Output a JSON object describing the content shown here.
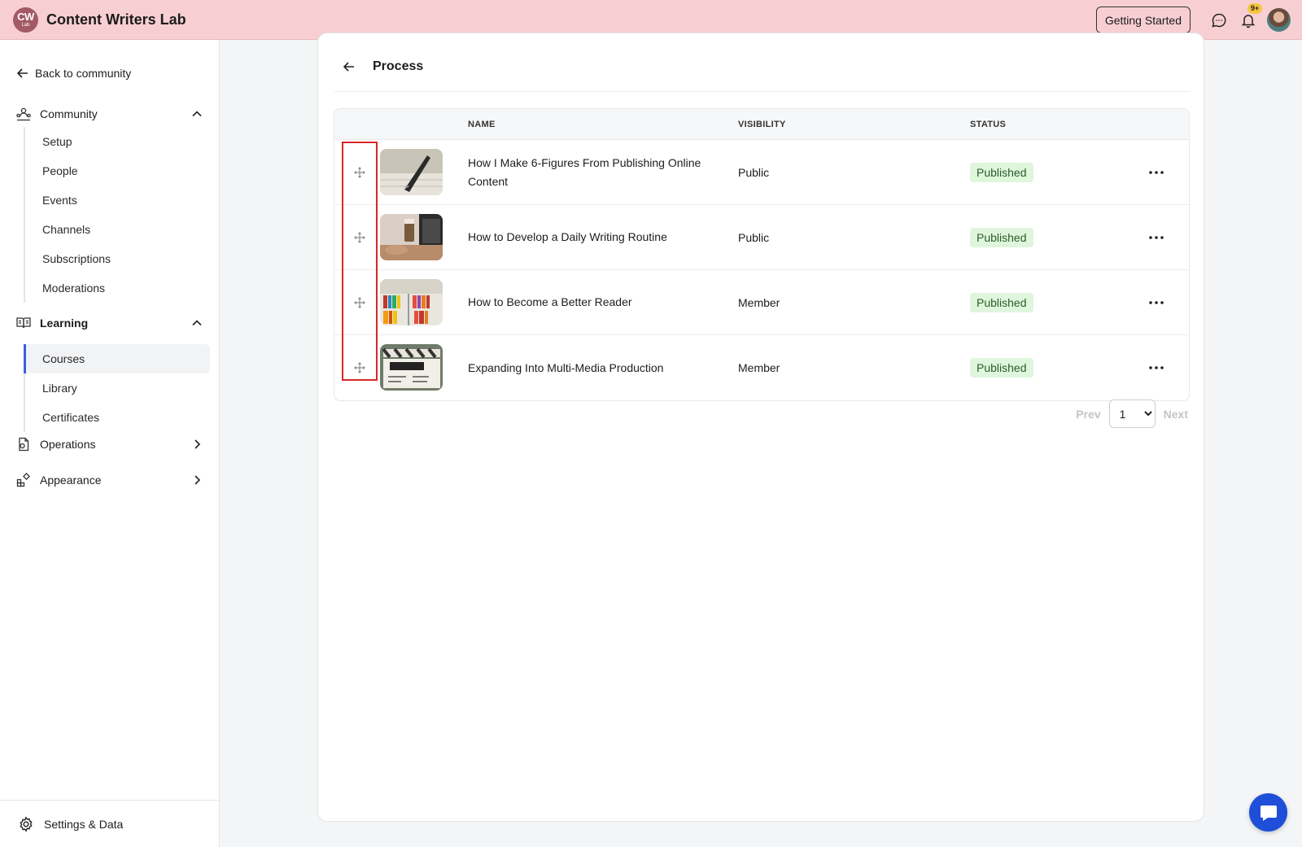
{
  "app": {
    "logo_text": "CW",
    "logo_subtext": "Lab",
    "title": "Content Writers Lab"
  },
  "header": {
    "getting_started_label": "Getting Started",
    "notifications_badge": "9+"
  },
  "sidebar": {
    "back_label": "Back to community",
    "sections": [
      {
        "label": "Community",
        "icon": "community-icon",
        "expanded": true,
        "items": [
          "Setup",
          "People",
          "Events",
          "Channels",
          "Subscriptions",
          "Moderations"
        ]
      },
      {
        "label": "Learning",
        "icon": "book-icon",
        "expanded": true,
        "items": [
          "Courses",
          "Library",
          "Certificates"
        ],
        "active_item": "Courses"
      },
      {
        "label": "Operations",
        "icon": "operations-icon",
        "expanded": false
      },
      {
        "label": "Appearance",
        "icon": "appearance-icon",
        "expanded": false
      }
    ],
    "footer_label": "Settings & Data"
  },
  "panel": {
    "title": "Process",
    "columns": {
      "name": "NAME",
      "visibility": "VISIBILITY",
      "status": "STATUS"
    },
    "rows": [
      {
        "name": "How I Make 6-Figures From Publishing Online Content",
        "visibility": "Public",
        "status": "Published"
      },
      {
        "name": "How to Develop a Daily Writing Routine",
        "visibility": "Public",
        "status": "Published"
      },
      {
        "name": "How to Become a Better Reader",
        "visibility": "Member",
        "status": "Published"
      },
      {
        "name": "Expanding Into Multi-Media Production",
        "visibility": "Member",
        "status": "Published"
      }
    ]
  },
  "pager": {
    "prev_label": "Prev",
    "next_label": "Next",
    "current_page": "1"
  },
  "colors": {
    "header_bg": "#f7cfd2",
    "accent": "#3b5fe0",
    "status_bg": "#dff6dc",
    "highlight": "#d62828",
    "chat_button": "#1f4fd8"
  }
}
